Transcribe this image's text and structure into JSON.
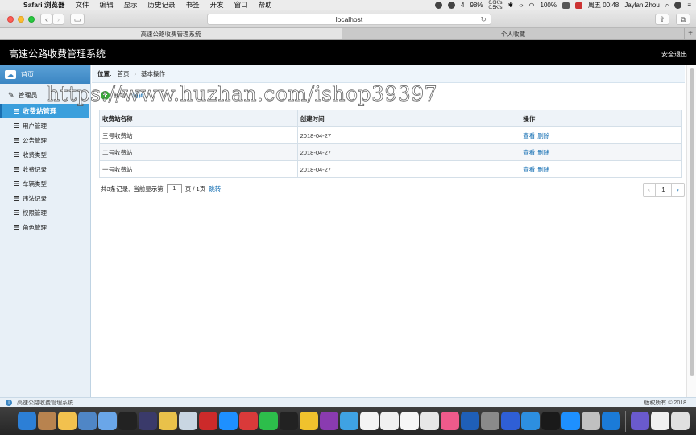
{
  "menubar": {
    "app": "Safari 浏览器",
    "items": [
      "文件",
      "编辑",
      "显示",
      "历史记录",
      "书签",
      "开发",
      "窗口",
      "帮助"
    ],
    "status": {
      "notify_count": "4",
      "battery": "98%",
      "net_up": "0.0K/s",
      "net_down": "0.5K/s",
      "zoom_pct": "100%",
      "datetime": "周五 00:48",
      "user": "Jaylan Zhou"
    }
  },
  "browser": {
    "url": "localhost",
    "tabs": [
      {
        "title": "高速公路收费管理系统",
        "active": true
      },
      {
        "title": "个人收藏",
        "active": false
      }
    ]
  },
  "header": {
    "title": "高速公路收费管理系统",
    "logout": "安全退出"
  },
  "sidebar": {
    "home": "首页",
    "group": "管理员",
    "items": [
      {
        "label": "收费站管理",
        "active": true
      },
      {
        "label": "用户管理"
      },
      {
        "label": "公告管理"
      },
      {
        "label": "收费类型"
      },
      {
        "label": "收费记录"
      },
      {
        "label": "车辆类型"
      },
      {
        "label": "违法记录"
      },
      {
        "label": "权限管理"
      },
      {
        "label": "角色管理"
      }
    ]
  },
  "breadcrumb": {
    "label": "位置:",
    "items": [
      "首页",
      "基本操作"
    ]
  },
  "actions": {
    "add": "新增",
    "second": "编辑"
  },
  "table": {
    "headers": [
      "收费站名称",
      "创建时间",
      "操作"
    ],
    "rows": [
      {
        "name": "三号收费站",
        "date": "2018-04-27"
      },
      {
        "name": "二号收费站",
        "date": "2018-04-27"
      },
      {
        "name": "一号收费站",
        "date": "2018-04-27"
      }
    ],
    "view": "查看",
    "delete": "删除"
  },
  "pager": {
    "total_prefix": "共3条记录,",
    "current_prefix": "当前显示第",
    "page_value": "1",
    "page_suffix": "页 / 1页",
    "jump": "跳转",
    "current": "1",
    "prev": "‹",
    "next": "›"
  },
  "footer": {
    "left": "高速公路收费管理系统",
    "right": "版权所有 © 2018"
  },
  "watermark": "https://www.huzhan.com/ishop39397",
  "dock_colors": [
    "#2c7fd6",
    "#b8834f",
    "#f2c14e",
    "#4f86c6",
    "#6aa6e8",
    "#222222",
    "#3a3a6a",
    "#e9c14a",
    "#c9d6e2",
    "#cc2a2a",
    "#1e90ff",
    "#d93a3a",
    "#2dbe4b",
    "#222222",
    "#f0c22d",
    "#8a3bb0",
    "#3fa2e3",
    "#f4f4f4",
    "#f0f0f0",
    "#f6f6f6",
    "#e7e7e7",
    "#ef5a8b",
    "#1f5fb8",
    "#8a8a8a",
    "#2f5fd6",
    "#2d8fe0",
    "#1a1a1a",
    "#1e90ff",
    "#c0c0c0",
    "#1b7bd8",
    "#6a5acd",
    "#f0f0f0",
    "#e0e0e0"
  ]
}
